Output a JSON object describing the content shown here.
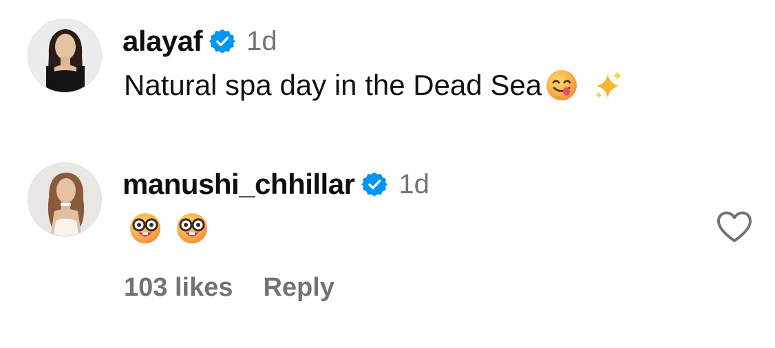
{
  "comments": [
    {
      "username": "alayaf",
      "verified": true,
      "timestamp": "1d",
      "text": "Natural spa day in the Dead Sea",
      "emojis": [
        "face-savoring-food-emoji",
        "sparkles-emoji"
      ]
    },
    {
      "username": "manushi_chhillar",
      "verified": true,
      "timestamp": "1d",
      "text": "",
      "emojis": [
        "nerd-face-emoji",
        "nerd-face-emoji"
      ],
      "likes_label": "103 likes",
      "reply_label": "Reply",
      "like_icon": "heart-outline-icon"
    }
  ],
  "colors": {
    "verified_blue": "#0095f6",
    "secondary_text": "#737373",
    "primary_text": "#111111"
  }
}
